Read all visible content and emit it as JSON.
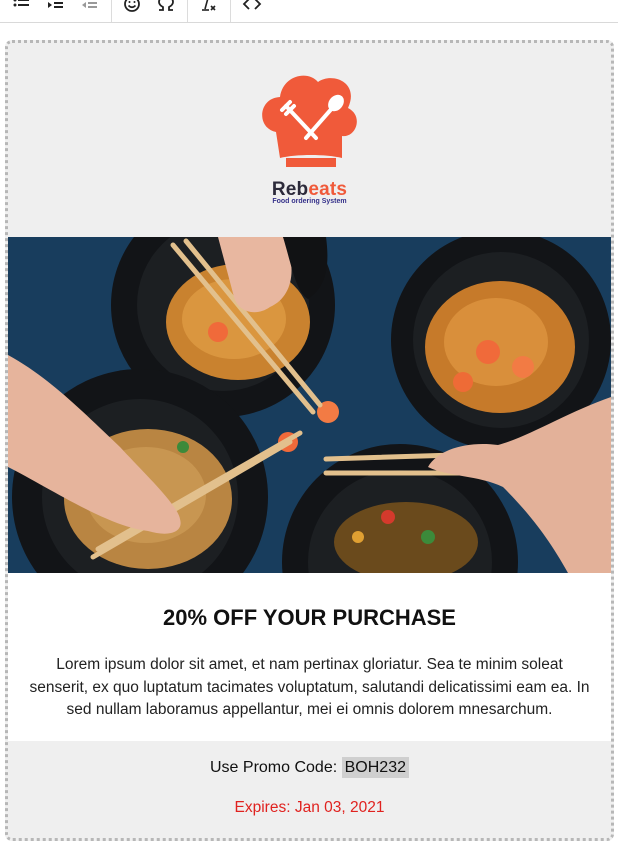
{
  "toolbar": {
    "icons": [
      "bulleted-list-icon",
      "indent-icon",
      "outdent-icon",
      "emoji-icon",
      "special-character-icon",
      "clear-formatting-icon",
      "source-code-icon"
    ]
  },
  "email": {
    "brand": {
      "part1": "Reb",
      "part2": "eats",
      "tagline": "Food ordering System"
    },
    "headline": "20% OFF YOUR PURCHASE",
    "body": "Lorem ipsum dolor sit amet, et nam pertinax gloriatur. Sea te minim soleat senserit, ex quo luptatum tacimates voluptatum, salutandi delicatissimi eam ea. In sed nullam laboramus appellantur, mei ei omnis dolorem mnesarchum.",
    "promo_label": "Use Promo Code:",
    "promo_code": "BOH232",
    "expires": "Expires: Jan 03, 2021"
  },
  "colors": {
    "brand_orange": "#f05a3a",
    "brand_dark": "#2c2a3a",
    "expires_red": "#e0221f"
  }
}
